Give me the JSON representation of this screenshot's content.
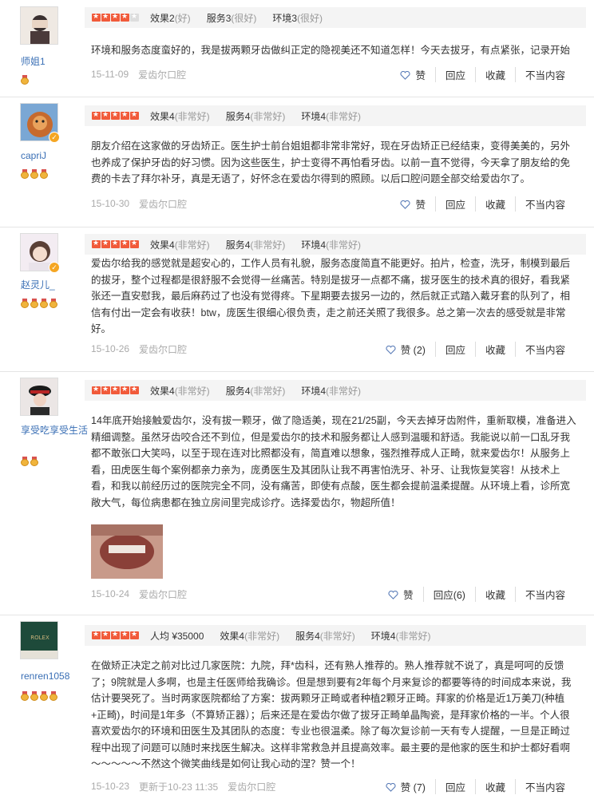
{
  "reviews": [
    {
      "user": "师姐1",
      "medals": 1,
      "verified": false,
      "stars": 4,
      "scores": [
        {
          "label": "效果2",
          "paren": "(好)"
        },
        {
          "label": "服务3",
          "paren": "(很好)"
        },
        {
          "label": "环境3",
          "paren": "(很好)"
        }
      ],
      "text": "环境和服务态度蛮好的，我是拔两颗牙齿做纠正定的隐视美还不知道怎样！今天去拔牙，有点紧张，记录开始",
      "date": "15-11-09",
      "clinic": "爱齿尔口腔",
      "like": "赞",
      "reply": "回应",
      "fav": "收藏",
      "report": "不当内容"
    },
    {
      "user": "capriJ",
      "medals": 3,
      "verified": true,
      "stars": 5,
      "scores": [
        {
          "label": "效果4",
          "paren": "(非常好)"
        },
        {
          "label": "服务4",
          "paren": "(非常好)"
        },
        {
          "label": "环境4",
          "paren": "(非常好)"
        }
      ],
      "text": "朋友介绍在这家做的牙齿矫正。医生护士前台姐姐都非常非常好，现在牙齿矫正已经结束，变得美美的，另外也养成了保护牙齿的好习惯。因为这些医生，护士变得不再怕看牙齿。以前一直不觉得，今天拿了朋友给的免费的卡去了拜尔补牙，真是无语了，好怀念在爱齿尔得到的照顾。以后口腔问题全部交给爱齿尔了。",
      "date": "15-10-30",
      "clinic": "爱齿尔口腔",
      "like": "赞",
      "reply": "回应",
      "fav": "收藏",
      "report": "不当内容"
    },
    {
      "user": "赵灵儿_",
      "medals": 4,
      "verified": true,
      "stars": 5,
      "scores": [
        {
          "label": "效果4",
          "paren": "(非常好)"
        },
        {
          "label": "服务4",
          "paren": "(非常好)"
        },
        {
          "label": "环境4",
          "paren": "(非常好)"
        }
      ],
      "text": "爱齿尔给我的感觉就是超安心的，工作人员有礼貌，服务态度简直不能更好。拍片，检查，洗牙，制模到最后的拔牙，整个过程都是很舒服不会觉得一丝痛苦。特别是拔牙一点都不痛，拔牙医生的技术真的很好，看我紧张还一直安慰我，最后麻药过了也没有觉得疼。下星期要去拔另一边的，然后就正式踏入戴牙套的队列了，相信有付出一定会有收获！btw，庞医生很细心很负责，走之前还关照了我很多。总之第一次去的感受就是非常好。",
      "date": "15-10-26",
      "clinic": "爱齿尔口腔",
      "like": "赞 (2)",
      "reply": "回应",
      "fav": "收藏",
      "report": "不当内容"
    },
    {
      "user": "享受吃享受生活",
      "medals": 2,
      "verified": false,
      "stars": 5,
      "scores": [
        {
          "label": "效果4",
          "paren": "(非常好)"
        },
        {
          "label": "服务4",
          "paren": "(非常好)"
        },
        {
          "label": "环境4",
          "paren": "(非常好)"
        }
      ],
      "text": "14年底开始接触爱齿尔，没有拔一颗牙，做了隐适美，现在21/25副，今天去掉牙齿附件，重新取模，准备进入精细调整。虽然牙齿咬合还不到位，但是爱齿尔的技术和服务都让人感到温暖和舒适。我能说以前一口乱牙我都不敢张口大笑吗，以至于现在连对比照都没有，简直难以想象，强烈推荐成人正畸，就来爱齿尔！从服务上看，田虎医生每个案例都亲力亲为，庞勇医生及其团队让我不再害怕洗牙、补牙、让我恢复笑容！从技术上看，和我以前经历过的医院完全不同，没有痛苦，即使有点酸，医生都会提前温柔提醒。从环境上看，诊所宽敞大气，每位病患都在独立房间里完成诊疗。选择爱齿尔，物超所值！",
      "date": "15-10-24",
      "clinic": "爱齿尔口腔",
      "like": "赞",
      "reply": "回应(6)",
      "fav": "收藏",
      "report": "不当内容"
    },
    {
      "user": "renren1058",
      "medals": 4,
      "verified": false,
      "stars": 5,
      "price": "人均 ¥35000",
      "scores": [
        {
          "label": "效果4",
          "paren": "(非常好)"
        },
        {
          "label": "服务4",
          "paren": "(非常好)"
        },
        {
          "label": "环境4",
          "paren": "(非常好)"
        }
      ],
      "text": "在做矫正决定之前对比过几家医院：九院，拜*齿科，还有熟人推荐的。熟人推荐就不说了，真是呵呵的反馈了；9院就是人多啊，也是主任医师给我确诊。但是想到要有2年每个月来复诊的都要等待的时间成本来说，我估计要哭死了。当时两家医院都给了方案：拔两颗牙正畸或者种植2颗牙正畸。拜家的价格是近1万美刀(种植+正畸)，时间是1年多（不算矫正器）；后来还是在爱齿尔做了拔牙正畸单晶陶瓷，是拜家价格的一半。个人很喜欢爱齿尔的环境和田医生及其团队的态度：专业也很温柔。除了每次复诊前一天有专人提醒，一旦是正畸过程中出现了问题可以随时来找医生解决。这样非常救急并且提高效率。最主要的是他家的医生和护士都好看啊～～～～～不然这个微笑曲线是如何让我心动的涅？赞一个！",
      "date": "15-10-23",
      "updated": "更新于10-23 11:35",
      "clinic": "爱齿尔口腔",
      "like": "赞 (7)",
      "reply": "回应",
      "fav": "收藏",
      "report": "不当内容"
    }
  ],
  "colors": {
    "username": "#3a6fb5",
    "star": "#f15a3a",
    "meta": "#aaaaaa",
    "scorebar": "#f4f4f4"
  }
}
